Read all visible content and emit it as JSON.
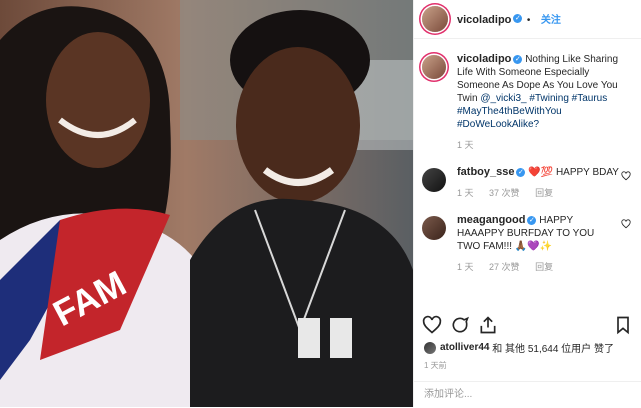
{
  "post": {
    "author": "vicoladipo",
    "follow_label": "关注",
    "caption": {
      "user": "vicoladipo",
      "text_before": "Nothing Like Sharing Life With Someone Especially Someone As Dope As You Love You Twin ",
      "mention": "@_vicki3_",
      "hashtags": "#Twining #Taurus #MayThe4thBeWithYou #DoWeLookAlike?",
      "time": "1 天"
    },
    "comments": [
      {
        "user": "fatboy_sse",
        "text": "❤️💯 HAPPY BDAY",
        "time": "1 天",
        "likes": "37 次赞",
        "reply": "回复"
      },
      {
        "user": "meagangood",
        "text": "HAPPY HAAAPPY BURFDAY TO YOU TWO FAM!!! 🙏🏾💜✨",
        "time": "1 天",
        "likes": "27 次赞",
        "reply": "回复"
      }
    ],
    "likes": {
      "user": "atolliver44",
      "rest": "和 其他 51,644 位用户 赞了"
    },
    "timestamp": "1 天前",
    "add_comment_placeholder": "添加评论..."
  },
  "colors": {
    "accent": "#3897f0",
    "heart": "#ed4956"
  }
}
